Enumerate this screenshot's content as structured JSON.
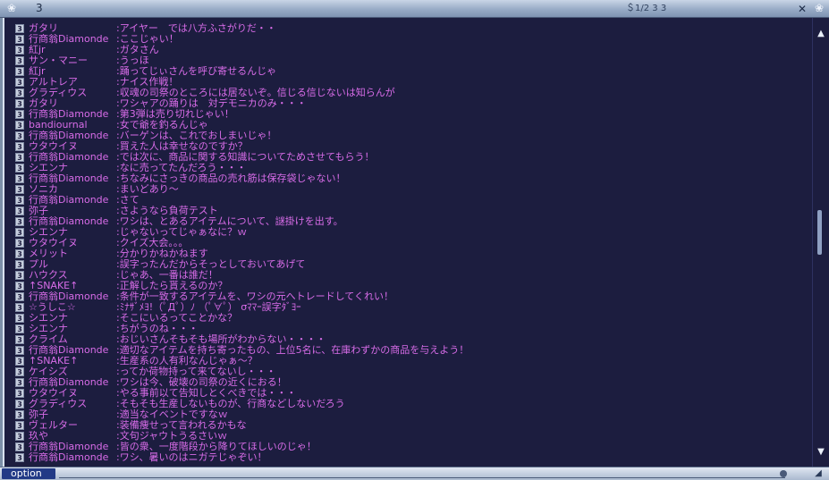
{
  "window": {
    "title": "3",
    "title_right": "＄1/2 3 3"
  },
  "colors": {
    "background": "#1c1d3f",
    "chat_text": "#d86ce8"
  },
  "chat": {
    "lines": [
      {
        "level": "3",
        "name": "ガタリ",
        "message": ":アイヤー　では八方ふさがりだ・・"
      },
      {
        "level": "3",
        "name": "行商翁Diamonde",
        "message": ":ここじゃい！"
      },
      {
        "level": "3",
        "name": "紅jr",
        "message": ":ガタさん"
      },
      {
        "level": "3",
        "name": "サン・マニー",
        "message": ":うっほ"
      },
      {
        "level": "3",
        "name": "紅jr",
        "message": ":踊ってじぃさんを呼び寄せるんじゃ"
      },
      {
        "level": "3",
        "name": "アルトレア",
        "message": ":ナイス作戦！"
      },
      {
        "level": "3",
        "name": "グラディウス",
        "message": ":収魂の司祭のところには居ないぞ。信じる信じないは知らんが"
      },
      {
        "level": "3",
        "name": "ガタリ",
        "message": ":ワシャアの踊りは　対デモニカのみ・・・"
      },
      {
        "level": "3",
        "name": "行商翁Diamonde",
        "message": ":第3弾は売り切れじゃい！"
      },
      {
        "level": "3",
        "name": "bandiournal",
        "message": ":女で爺を釣るんじゃ"
      },
      {
        "level": "3",
        "name": "行商翁Diamonde",
        "message": ":バーゲンは、これでおしまいじゃ！"
      },
      {
        "level": "3",
        "name": "ウタウイヌ",
        "message": ":買えた人は幸せなのですか？"
      },
      {
        "level": "3",
        "name": "行商翁Diamonde",
        "message": ":では次に、商品に関する知識についてためさせてもらう！"
      },
      {
        "level": "3",
        "name": "シエンナ",
        "message": ":なに売ってたんだろう・・・"
      },
      {
        "level": "3",
        "name": "行商翁Diamonde",
        "message": ":ちなみにさっきの商品の売れ筋は保存袋じゃない！"
      },
      {
        "level": "3",
        "name": "ソニカ",
        "message": ":まいどあり～"
      },
      {
        "level": "3",
        "name": "行商翁Diamonde",
        "message": ":さて"
      },
      {
        "level": "3",
        "name": "弥子",
        "message": ":さようなら負荷テスト"
      },
      {
        "level": "3",
        "name": "行商翁Diamonde",
        "message": ":ワシは、とあるアイテムについて、謎掛けを出す。"
      },
      {
        "level": "3",
        "name": "シエンナ",
        "message": ":じゃないってじゃぁなに？ｗ"
      },
      {
        "level": "3",
        "name": "ウタウイヌ",
        "message": ":クイズ大会。。。"
      },
      {
        "level": "3",
        "name": "メリット",
        "message": ":分かりかねかねます"
      },
      {
        "level": "3",
        "name": "プル",
        "message": ":誤字ったんだからそっとしておいてあげて"
      },
      {
        "level": "3",
        "name": "ハウクス",
        "message": ":じゃあ、一番は誰だ！"
      },
      {
        "level": "3",
        "name": "↑SNAKE↑",
        "message": ":正解したら貰えるのか？"
      },
      {
        "level": "3",
        "name": "行商翁Diamonde",
        "message": ":条件が一致するアイテムを、ワシの元へトレードしてくれい！"
      },
      {
        "level": "3",
        "name": "☆うしこ☆",
        "message": ":ﾐﾅｻﾞﾒﾖ!（ﾟДﾟ）ﾉ （ﾟ∀ﾟ） σﾏﾏｰ誤字ﾀﾞﾖｰ"
      },
      {
        "level": "3",
        "name": "シエンナ",
        "message": ":そこにいるってことかな？"
      },
      {
        "level": "3",
        "name": "シエンナ",
        "message": ":ちがうのね・・・"
      },
      {
        "level": "3",
        "name": "クライム",
        "message": ":おじいさんそもそも場所がわからない・・・・"
      },
      {
        "level": "3",
        "name": "行商翁Diamonde",
        "message": ":適切なアイテムを持ち寄ったもの、上位5名に、在庫わずかの商品を与えよう！"
      },
      {
        "level": "3",
        "name": "↑SNAKE↑",
        "message": ":生産系の人有利なんじゃぁ～？"
      },
      {
        "level": "3",
        "name": "ケイシズ",
        "message": ":ってか荷物持って来てないし・・・"
      },
      {
        "level": "3",
        "name": "行商翁Diamonde",
        "message": ":ワシは今、破壊の司祭の近くにおる！"
      },
      {
        "level": "3",
        "name": "ウタウイヌ",
        "message": ":やる事前以て告知しとくべきでは・・・"
      },
      {
        "level": "3",
        "name": "グラディウス",
        "message": ":そもそも生産しないものが、行商などしないだろう"
      },
      {
        "level": "3",
        "name": "弥子",
        "message": ":適当なイベントですなｗ"
      },
      {
        "level": "3",
        "name": "ヴェルター",
        "message": ":装備痩せって言われるかもな"
      },
      {
        "level": "3",
        "name": "玖や",
        "message": ":文句ジャウトうるさいｗ"
      },
      {
        "level": "3",
        "name": "行商翁Diamonde",
        "message": ":皆の衆、一度階段から降りてほしいのじゃ！"
      },
      {
        "level": "3",
        "name": "行商翁Diamonde",
        "message": ":ワシ、暑いのはニガテじゃぞい！"
      }
    ]
  },
  "bottom": {
    "option_label": "option"
  }
}
